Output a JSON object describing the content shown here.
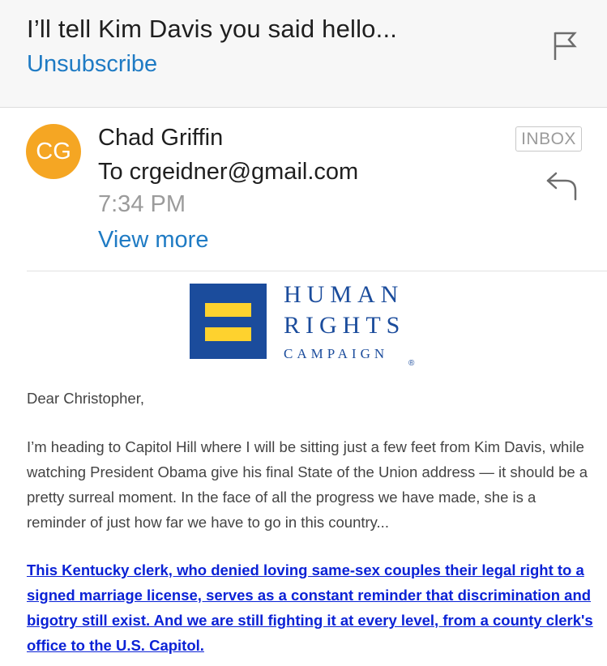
{
  "header": {
    "subject": "I’ll tell Kim Davis you said hello...",
    "unsubscribe_label": "Unsubscribe",
    "flag_icon": "flag-icon"
  },
  "message": {
    "avatar_initials": "CG",
    "avatar_color": "#f5a623",
    "sender": "Chad Griffin",
    "to_line": "To crgeidner@gmail.com",
    "time": "7:34 PM",
    "view_more_label": "View more",
    "folder_badge": "INBOX",
    "reply_icon": "reply-icon"
  },
  "logo": {
    "line1": "HUMAN",
    "line2": "RIGHTS",
    "line3": "CAMPAIGN",
    "registered": "®",
    "brand_blue": "#1b4c9c",
    "brand_yellow": "#fed22e"
  },
  "content": {
    "greeting": "Dear Christopher,",
    "paragraph": "I’m heading to Capitol Hill where I will be sitting just a few feet from Kim Davis, while watching President Obama give his final State of the Union address — it should be a pretty surreal moment. In the face of all the progress we have made, she is a reminder of just how far we have to go in this country...",
    "link_paragraph": "This Kentucky clerk, who denied loving same-sex couples their legal right to a signed marriage license, serves as a constant reminder that discrimination and bigotry still exist. And we are still fighting it at every level, from a county clerk's office to the U.S. Capitol."
  },
  "colors": {
    "link_blue": "#1f7bc4",
    "body_link": "#0b22d6"
  }
}
